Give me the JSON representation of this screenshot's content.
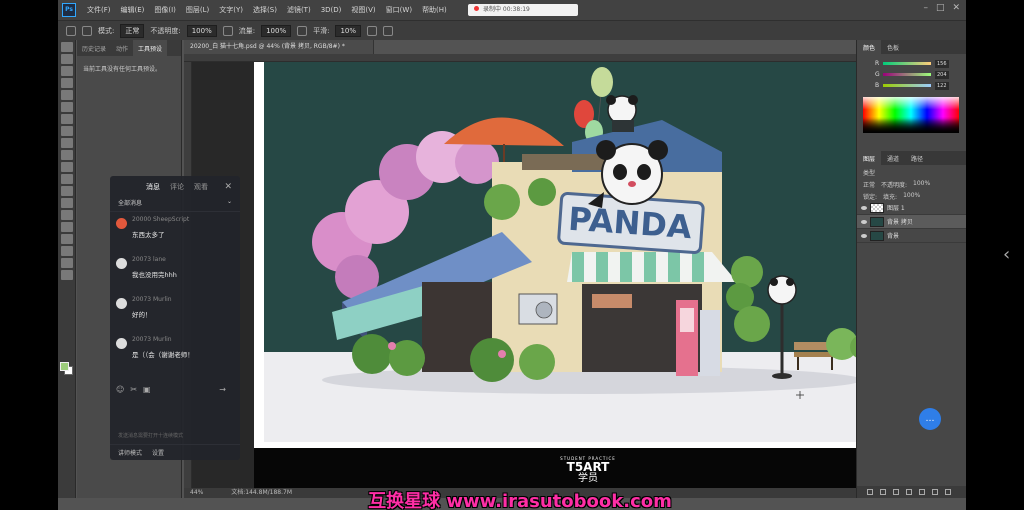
{
  "menubar": {
    "logo": "Ps",
    "items": [
      "文件(F)",
      "编辑(E)",
      "图像(I)",
      "图层(L)",
      "文字(Y)",
      "选择(S)",
      "滤镜(T)",
      "3D(D)",
      "视图(V)",
      "窗口(W)",
      "帮助(H)"
    ],
    "recording": "录制中 00:38:19"
  },
  "options": {
    "mode_label": "模式:",
    "mode_value": "正常",
    "opacity_label": "不透明度:",
    "opacity_value": "100%",
    "flow_label": "流量:",
    "flow_value": "100%",
    "smooth_label": "平滑:",
    "smooth_value": "10%"
  },
  "left_panel": {
    "tabs": [
      "历史记录",
      "动作",
      "工具预设"
    ],
    "history_text": "当前工具没有任何工具预设。"
  },
  "document": {
    "tab_title": "20200_白 猫十七角.psd @ 44% (背景 拷贝, RGB/8#) *",
    "zoom": "44%",
    "doc_info": "文档:144.8M/188.7M"
  },
  "chat": {
    "tabs": [
      "消息",
      "评论",
      "观看"
    ],
    "active_tab": "消息",
    "close": "✕",
    "filter": "全部消息",
    "messages": [
      {
        "name": "20000 SheepScript",
        "text": "东西太多了"
      },
      {
        "name": "20073 lane",
        "text": "我也没用完hhh"
      },
      {
        "name": "20073 Murlin",
        "text": "好的！"
      },
      {
        "name": "20073 Murlin",
        "text": "是（（会（谢谢老师！"
      }
    ],
    "input_icons": [
      "☺",
      "✂",
      "▣"
    ],
    "send": "→",
    "hint": "发送消息需要打开十连续模式",
    "footer": [
      "讲师模式",
      "设置"
    ]
  },
  "right_panel": {
    "color_tabs": [
      "颜色",
      "色板"
    ],
    "sliders": [
      {
        "label": "R",
        "value": "156"
      },
      {
        "label": "G",
        "value": "204"
      },
      {
        "label": "B",
        "value": "122"
      }
    ],
    "adjust_tabs": [
      "图层",
      "通道",
      "路径"
    ],
    "blend": "正常",
    "opacity_label": "不透明度:",
    "opacity_value": "100%",
    "lock_label": "锁定:",
    "fill_label": "填充:",
    "fill_value": "100%",
    "kind_label": "类型",
    "layers": [
      {
        "name": "图层 1",
        "selected": false
      },
      {
        "name": "背景 拷贝",
        "selected": true
      },
      {
        "name": "背景",
        "selected": false
      }
    ]
  },
  "colors": {
    "fg": "#9ccc7a",
    "canvas_bg": "#264845",
    "accent": "#31a8ff",
    "watermark": "#ff2ea6"
  },
  "artwork": {
    "sign_text": "PANDA"
  },
  "brand": {
    "small": "STUDENT PRACTICE",
    "big": "T5ART",
    "cn": "学员"
  },
  "watermark": "互换星球 www.irasutobook.com"
}
